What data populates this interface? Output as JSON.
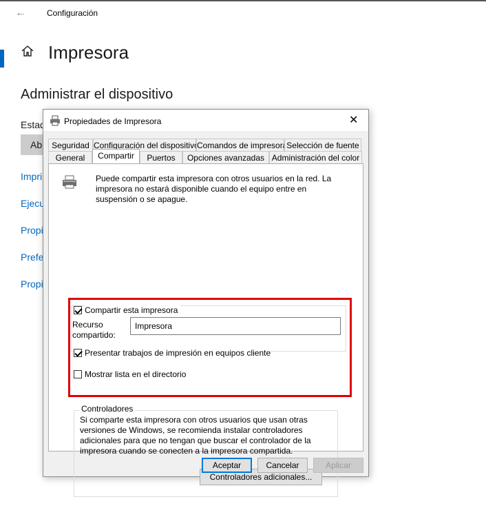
{
  "window": {
    "title": "Configuración"
  },
  "page": {
    "title": "Impresora",
    "section": "Administrar el dispositivo"
  },
  "status": {
    "label": "Estad",
    "open_button": "Ab"
  },
  "links": [
    "Impri",
    "Ejecu",
    "Propi",
    "Prefe",
    "Propi"
  ],
  "dialog": {
    "title": "Propiedades de Impresora",
    "tabs_row1": [
      "Seguridad",
      "Configuración del dispositivo",
      "Comandos de impresora",
      "Selección de fuente"
    ],
    "tabs_row2": [
      "General",
      "Compartir",
      "Puertos",
      "Opciones avanzadas",
      "Administración del color"
    ],
    "active_tab": "Compartir",
    "info_text": "Puede compartir esta impresora con otros usuarios en la red. La impresora no estará disponible cuando el equipo entre en suspensión o se apague.",
    "share": {
      "share_label": "Compartir esta impresora",
      "share_checked": true,
      "resource_label_1": "Recurso",
      "resource_label_2": "compartido:",
      "resource_value": "Impresora",
      "render_label": "Presentar trabajos de impresión en equipos cliente",
      "render_checked": true,
      "directory_label": "Mostrar lista en el directorio",
      "directory_checked": false
    },
    "drivers": {
      "title": "Controladores",
      "text": "Si comparte esta impresora con otros usuarios que usan otras versiones de Windows, se recomienda instalar controladores adicionales para que no tengan que buscar el controlador de la impresora cuando se conecten a la impresora compartida.",
      "button": "Controladores adicionales..."
    },
    "buttons": {
      "ok": "Aceptar",
      "cancel": "Cancelar",
      "apply": "Aplicar"
    }
  },
  "colors": {
    "highlight": "#e00000",
    "accent": "#0067c0"
  },
  "icons": [
    "back-arrow-icon",
    "home-icon",
    "printer-icon",
    "close-icon"
  ]
}
